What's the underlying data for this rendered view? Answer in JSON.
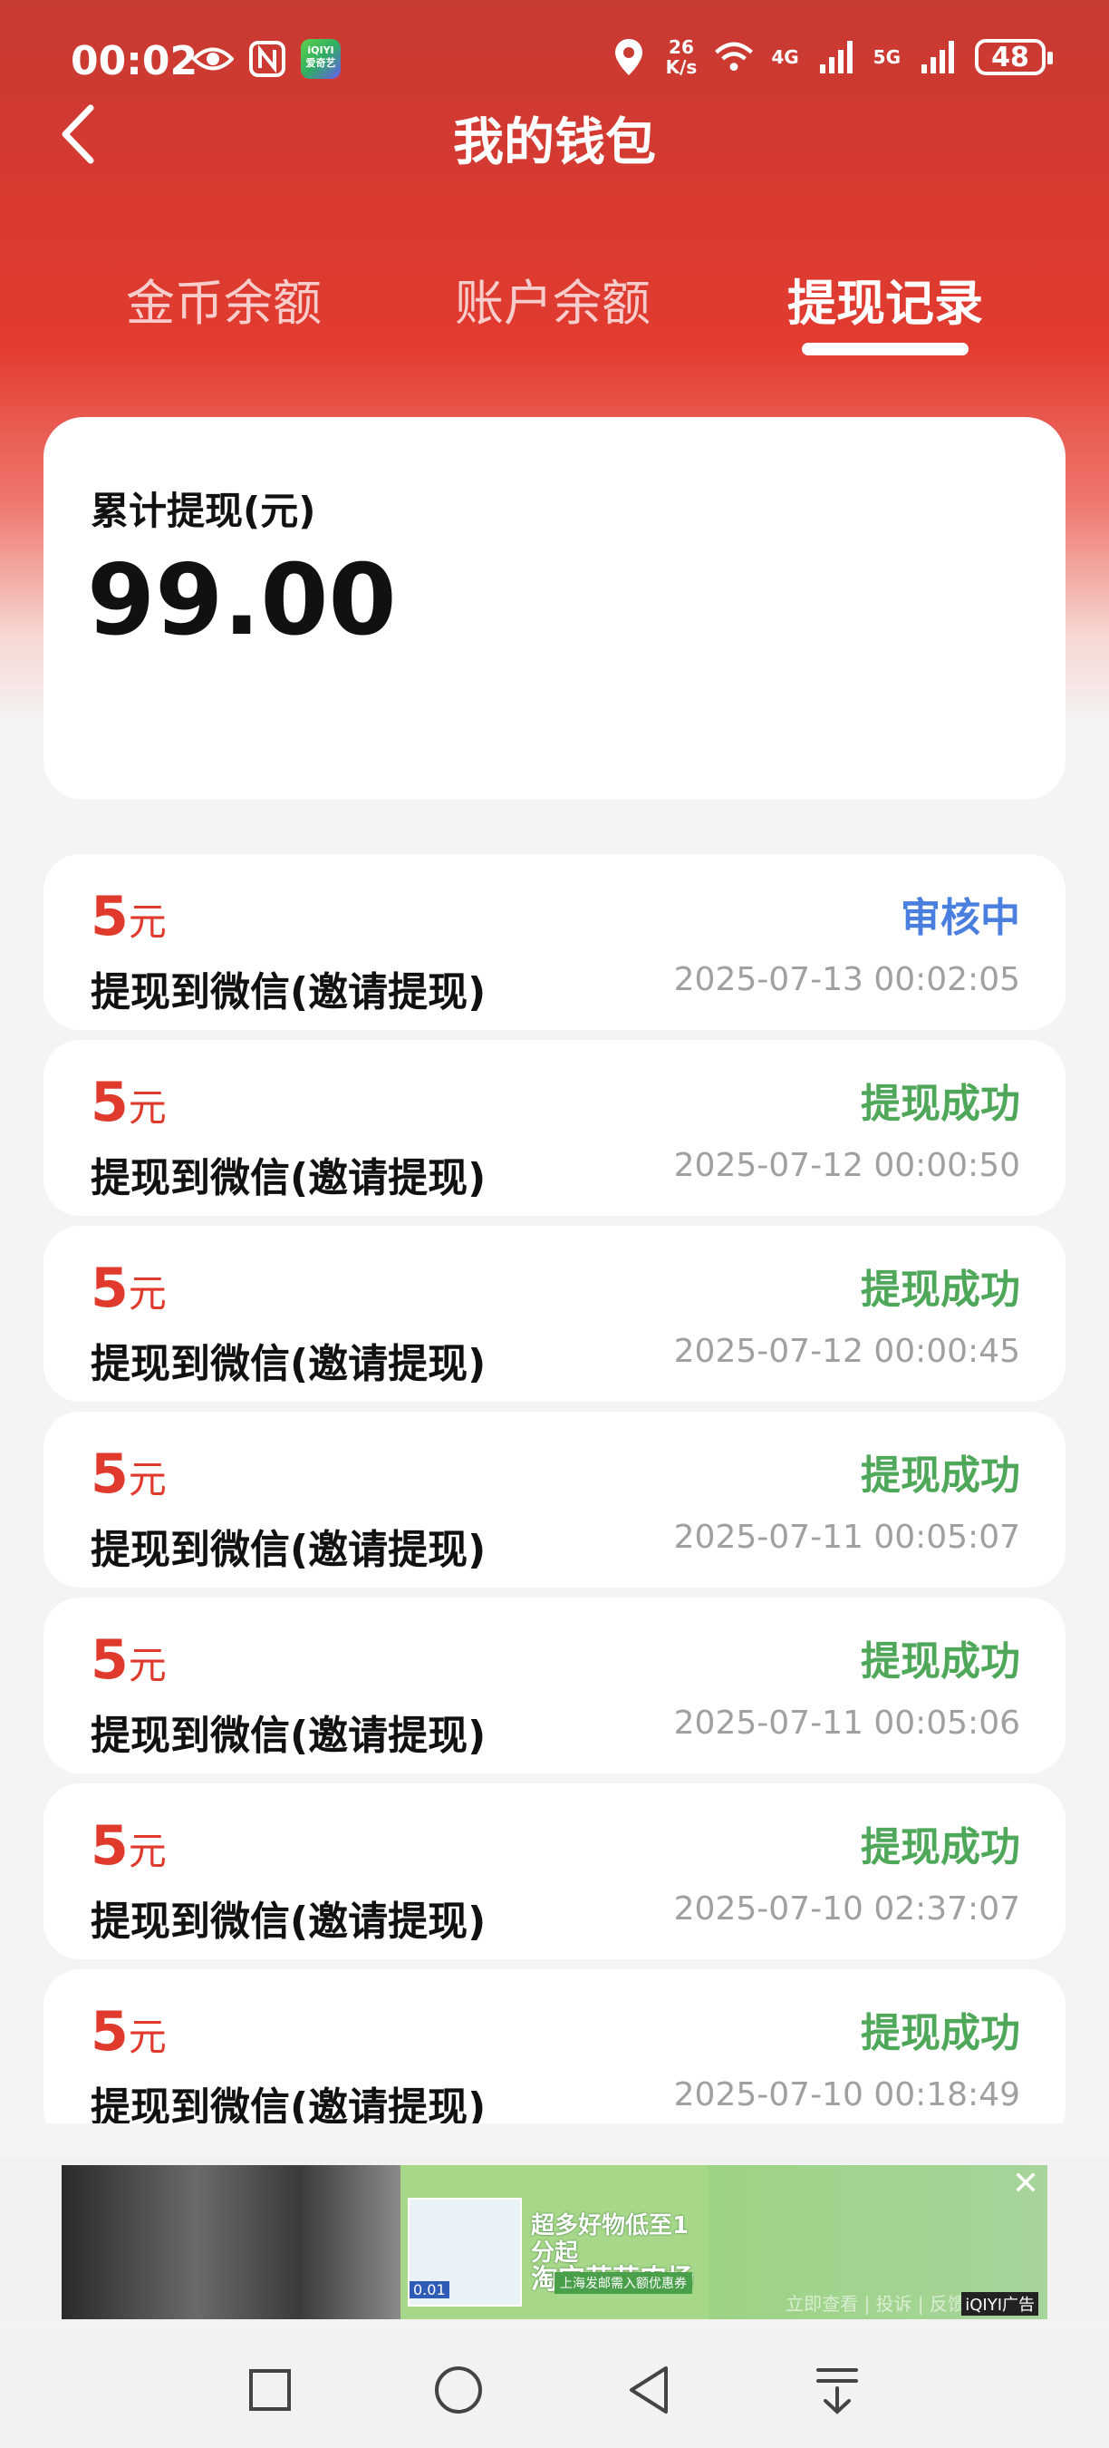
{
  "status_bar": {
    "time": "00:02",
    "app_badge": "iQIYI\n爱奇艺",
    "net_speed_value": "26",
    "net_speed_unit": "K/s",
    "network_4g": "4G",
    "network_5g": "5G",
    "battery": "48",
    "icons": [
      "eye-icon",
      "nfc-icon",
      "iqiyi-app-icon",
      "location-icon",
      "wifi-icon",
      "signal-icon",
      "battery-icon"
    ]
  },
  "header": {
    "title": "我的钱包",
    "back_icon": "chevron-left-icon"
  },
  "tabs": [
    {
      "label": "金币余额",
      "active": false
    },
    {
      "label": "账户余额",
      "active": false
    },
    {
      "label": "提现记录",
      "active": true
    }
  ],
  "summary": {
    "label": "累计提现(元)",
    "value": "99.00"
  },
  "records": [
    {
      "amount": "5",
      "unit": "元",
      "desc": "提现到微信(邀请提现)",
      "status": "审核中",
      "status_type": "pending",
      "time": "2025-07-13 00:02:05"
    },
    {
      "amount": "5",
      "unit": "元",
      "desc": "提现到微信(邀请提现)",
      "status": "提现成功",
      "status_type": "success",
      "time": "2025-07-12 00:00:50"
    },
    {
      "amount": "5",
      "unit": "元",
      "desc": "提现到微信(邀请提现)",
      "status": "提现成功",
      "status_type": "success",
      "time": "2025-07-12 00:00:45"
    },
    {
      "amount": "5",
      "unit": "元",
      "desc": "提现到微信(邀请提现)",
      "status": "提现成功",
      "status_type": "success",
      "time": "2025-07-11 00:05:07"
    },
    {
      "amount": "5",
      "unit": "元",
      "desc": "提现到微信(邀请提现)",
      "status": "提现成功",
      "status_type": "success",
      "time": "2025-07-11 00:05:06"
    },
    {
      "amount": "5",
      "unit": "元",
      "desc": "提现到微信(邀请提现)",
      "status": "提现成功",
      "status_type": "success",
      "time": "2025-07-10 02:37:07"
    },
    {
      "amount": "5",
      "unit": "元",
      "desc": "提现到微信(邀请提现)",
      "status": "提现成功",
      "status_type": "success",
      "time": "2025-07-10 00:18:49"
    }
  ],
  "ad": {
    "headline_line1": "超多好物低至1分起",
    "headline_line2": "淘宝芭芭农场",
    "tag": "上海发邮需入额优惠券",
    "price": "0.01",
    "faint_text": "立即查看 | 投诉 | 反馈",
    "brand": "iQIYI广告",
    "close": "✕"
  },
  "nav_bar": {
    "icons": [
      "recent-apps-icon",
      "home-icon",
      "back-icon",
      "notification-pull-icon"
    ]
  },
  "colors": {
    "header_red": "#e33b30",
    "amount_red": "#e03a2c",
    "pending_blue": "#4a7fe0",
    "success_green": "#4fa75a"
  }
}
